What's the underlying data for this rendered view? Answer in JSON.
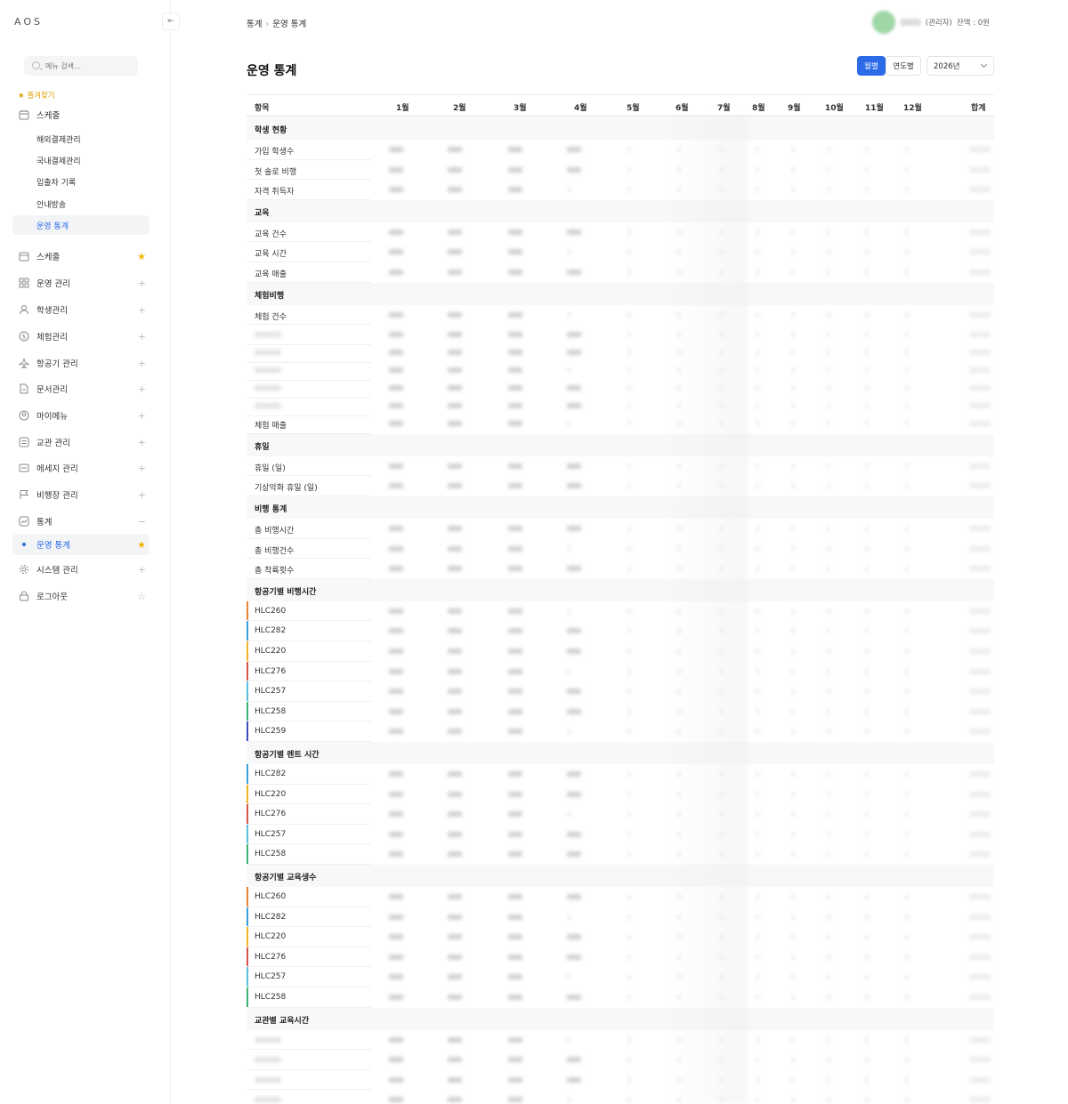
{
  "app": {
    "logo": "AOS",
    "collapse_icon": "⇤"
  },
  "sidebar": {
    "search_placeholder": "메뉴 검색...",
    "favorites_label": "★ 즐겨찾기",
    "favorites": {
      "group": "스케줄",
      "items": [
        {
          "label": "해외결제관리"
        },
        {
          "label": "국내결제관리"
        },
        {
          "label": "입출차 기록"
        },
        {
          "label": "안내방송"
        },
        {
          "label": "운영 통계",
          "active": true
        }
      ]
    },
    "menu": [
      {
        "label": "스케줄",
        "icon": "calendar-icon",
        "right": "★"
      },
      {
        "label": "운영 관리",
        "icon": "grid-icon",
        "right": "+"
      },
      {
        "label": "학생관리",
        "icon": "user-icon",
        "right": "+"
      },
      {
        "label": "체험관리",
        "icon": "dollar-icon",
        "right": "+"
      },
      {
        "label": "항공기 관리",
        "icon": "plane-icon",
        "right": "+"
      },
      {
        "label": "문서관리",
        "icon": "document-icon",
        "right": "+"
      },
      {
        "label": "마이메뉴",
        "icon": "profile-icon",
        "right": "+"
      },
      {
        "label": "교관 관리",
        "icon": "list-icon",
        "right": "+"
      },
      {
        "label": "메세지 관리",
        "icon": "message-icon",
        "right": "+"
      },
      {
        "label": "비행장 관리",
        "icon": "flag-icon",
        "right": "+"
      },
      {
        "label": "통계",
        "icon": "chart-icon",
        "right": "−"
      }
    ],
    "stats_sub": {
      "label": "운영 통계",
      "right": "★"
    },
    "menu_bottom": [
      {
        "label": "시스템 관리",
        "icon": "gear-icon",
        "right": "+"
      },
      {
        "label": "로그아웃",
        "icon": "lock-icon",
        "right": "☆"
      }
    ]
  },
  "header": {
    "breadcrumb": [
      "통계",
      "운영 통계"
    ],
    "user_role": "(관리자)",
    "balance": "잔액 : 0원"
  },
  "page": {
    "title": "운영 통계",
    "view_monthly": "월별",
    "view_yearly": "연도별",
    "year": "2026년"
  },
  "table": {
    "columns": [
      "항목",
      "1월",
      "2월",
      "3월",
      "4월",
      "5월",
      "6월",
      "7월",
      "8월",
      "9월",
      "10월",
      "11월",
      "12월",
      "합계"
    ],
    "sections": [
      {
        "title": "학생 현황",
        "rows": [
          "가입 학생수",
          "첫 솔로 비행",
          "자격 취득자"
        ]
      },
      {
        "title": "교육",
        "rows": [
          "교육 건수",
          "교육 시간",
          "교육 매출"
        ]
      },
      {
        "title": "체험비행",
        "rows": [
          "체험 건수",
          "",
          "",
          "",
          "",
          "",
          "체험 매출"
        ]
      },
      {
        "title": "휴일",
        "rows": [
          "휴일 (일)",
          "기상악화 휴일 (일)"
        ]
      },
      {
        "title": "비행 통계",
        "rows": [
          "총 비행시간",
          "총 비행건수",
          "총 착륙횟수"
        ]
      },
      {
        "title": "항공기별 비행시간",
        "rows": [
          "HLC260",
          "HLC282",
          "HLC220",
          "HLC276",
          "HLC257",
          "HLC258",
          "HLC259"
        ]
      },
      {
        "title": "항공기별 렌트 시간",
        "rows": [
          "HLC282",
          "HLC220",
          "HLC276",
          "HLC257",
          "HLC258"
        ]
      },
      {
        "title": "항공기별 교육생수",
        "rows": [
          "HLC260",
          "HLC282",
          "HLC220",
          "HLC276",
          "HLC257",
          "HLC258"
        ]
      },
      {
        "title": "교관별 교육시간",
        "rows": [
          "",
          "",
          "",
          ""
        ]
      }
    ],
    "aircraft_colors": {
      "HLC260": "#e8833a",
      "HLC282": "#3aa0d8",
      "HLC220": "#f0b429",
      "HLC276": "#d9534f",
      "HLC257": "#5bc0de",
      "HLC258": "#3cb371",
      "HLC259": "#3b4cc0"
    }
  }
}
